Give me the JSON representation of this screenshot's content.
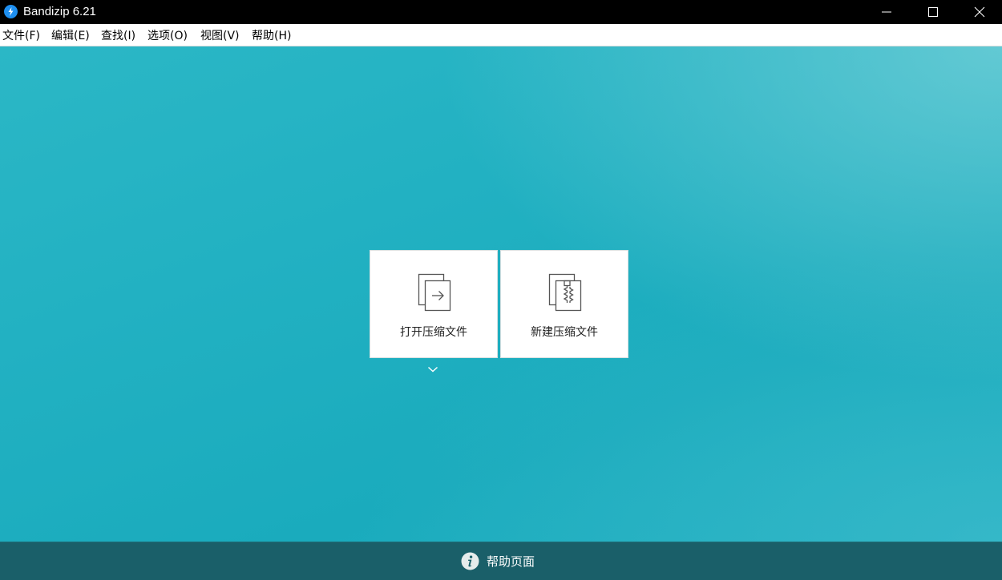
{
  "window": {
    "title": "Bandizip 6.21"
  },
  "menubar": {
    "items": [
      {
        "label": "文件(F)"
      },
      {
        "label": "编辑(E)"
      },
      {
        "label": "查找(I)"
      },
      {
        "label": "选项(O)"
      },
      {
        "label": "视图(V)"
      },
      {
        "label": "帮助(H)"
      }
    ]
  },
  "main": {
    "open_archive_label": "打开压缩文件",
    "new_archive_label": "新建压缩文件",
    "open_archive_icon": "open-archive-icon",
    "new_archive_icon": "zip-archive-icon",
    "dropdown_icon": "chevron-down-icon"
  },
  "footer": {
    "help_label": "帮助页面",
    "help_icon": "info-icon"
  },
  "colors": {
    "titlebar": "#000000",
    "main_background": "#22b1c2",
    "footer": "#1a5f69",
    "app_icon": "#1e8ff0"
  }
}
